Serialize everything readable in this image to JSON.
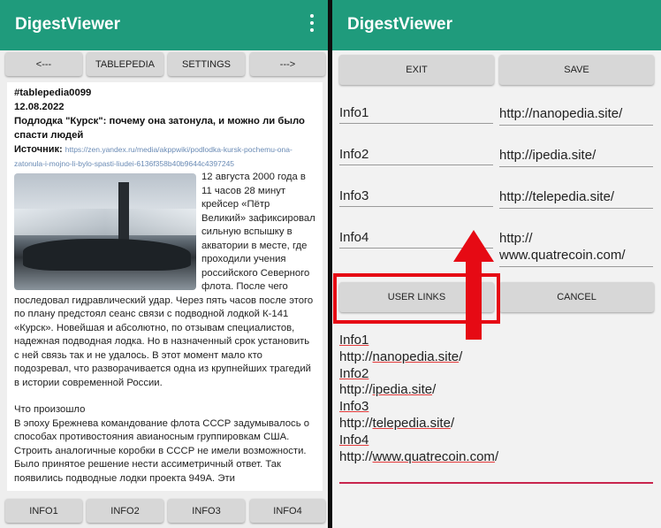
{
  "left": {
    "app_title": "DigestViewer",
    "nav": {
      "prev": "<---",
      "tablepedia": "TABLEPEDIA",
      "settings": "SETTINGS",
      "next": "--->"
    },
    "article": {
      "tag": "#tablepedia0099",
      "date": "12.08.2022",
      "headline": "Подлодка \"Курск\": почему она затонула, и можно ли было спасти людей",
      "source_label": "Источник:",
      "source_url": "https://zen.yandex.ru/media/akppwiki/podlodka-kursk-pochemu-ona-zatonula-i-mojno-li-bylo-spasti-liudei-6136f358b40b9644c4397245",
      "paragraph1": "12 августа 2000 года в 11 часов 28 минут крейсер «Пётр Великий» зафиксировал сильную вспышку в акватории в месте, где проходили учения российского Северного флота. После чего последовал гидравлический удар. Через пять часов после этого по плану предстоял сеанс связи с подводной лодкой К-141 «Курск». Новейшая и абсолютно, по отзывам специалистов, надежная подводная лодка. Но в назначенный срок установить с ней связь так и не удалось. В этот момент мало кто подозревал, что разворачивается одна из крупнейших трагедий в истории современной России.",
      "subheading": "Что произошло",
      "paragraph2": "В эпоху Брежнева командование флота СССР задумывалось о способах противостояния авианосным группировкам США. Строить аналогичные коробки в СССР не имели возможности. Было принятое решение нести ассиметричный ответ. Так появились подводные лодки проекта 949А. Эти"
    },
    "bottom_buttons": [
      "INFO1",
      "INFO2",
      "INFO3",
      "INFO4"
    ]
  },
  "right": {
    "app_title": "DigestViewer",
    "exit": "EXIT",
    "save": "SAVE",
    "rows": [
      {
        "label": "Info1",
        "url": "http://nanopedia.site/"
      },
      {
        "label": "Info2",
        "url": "http://ipedia.site/"
      },
      {
        "label": "Info3",
        "url": "http://telepedia.site/"
      },
      {
        "label": "Info4",
        "url": "http://\nwww.quatrecoin.com/"
      }
    ],
    "user_links": "USER LINKS",
    "cancel": "CANCEL",
    "links_text": [
      {
        "l": "Info1",
        "p": "http://",
        "d": "nanopedia.site",
        "s": "/"
      },
      {
        "l": "Info2",
        "p": "http://",
        "d": "ipedia.site",
        "s": "/"
      },
      {
        "l": "Info3",
        "p": "http://",
        "d": "telepedia.site",
        "s": "/"
      },
      {
        "l": "Info4",
        "p": "http://",
        "d": "www.quatrecoin.com",
        "s": "/"
      }
    ]
  },
  "colors": {
    "appbar": "#1f9b7c",
    "highlight": "#e60a14",
    "accent_line": "#c8254d"
  }
}
